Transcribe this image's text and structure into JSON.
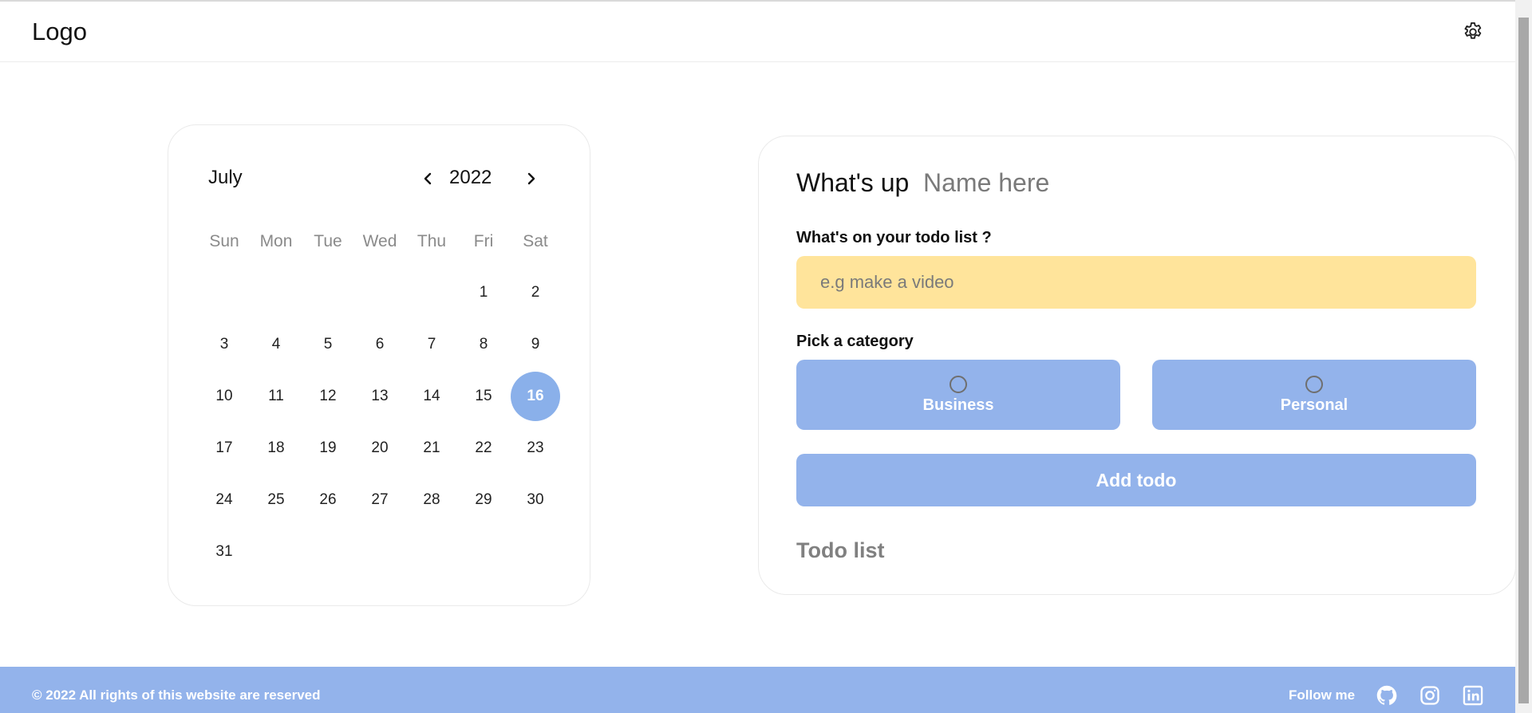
{
  "header": {
    "logo": "Logo",
    "settings_icon": "gear-icon"
  },
  "calendar": {
    "month": "July",
    "year": "2022",
    "prev_icon": "chevron-left-icon",
    "next_icon": "chevron-right-icon",
    "weekdays": [
      "Sun",
      "Mon",
      "Tue",
      "Wed",
      "Thu",
      "Fri",
      "Sat"
    ],
    "days": [
      "1",
      "2",
      "3",
      "4",
      "5",
      "6",
      "7",
      "8",
      "9",
      "10",
      "11",
      "12",
      "13",
      "14",
      "15",
      "16",
      "17",
      "18",
      "19",
      "20",
      "21",
      "22",
      "23",
      "24",
      "25",
      "26",
      "27",
      "28",
      "29",
      "30",
      "31"
    ],
    "selected_day": "16",
    "accent_color": "#8ab0ea"
  },
  "todo": {
    "greeting": "What's up",
    "name_placeholder": "Name here",
    "todo_label": "What's on your todo list ?",
    "todo_placeholder": "e.g make a video",
    "input_color": "#ffe49b",
    "category_label": "Pick a category",
    "categories": [
      "Business",
      "Personal"
    ],
    "add_button": "Add todo",
    "list_title": "Todo list",
    "button_color": "#93b3eb"
  },
  "footer": {
    "copyright": "© 2022 All rights of this website are reserved",
    "follow": "Follow me",
    "social_icons": [
      "github-icon",
      "instagram-icon",
      "linkedin-icon"
    ]
  }
}
